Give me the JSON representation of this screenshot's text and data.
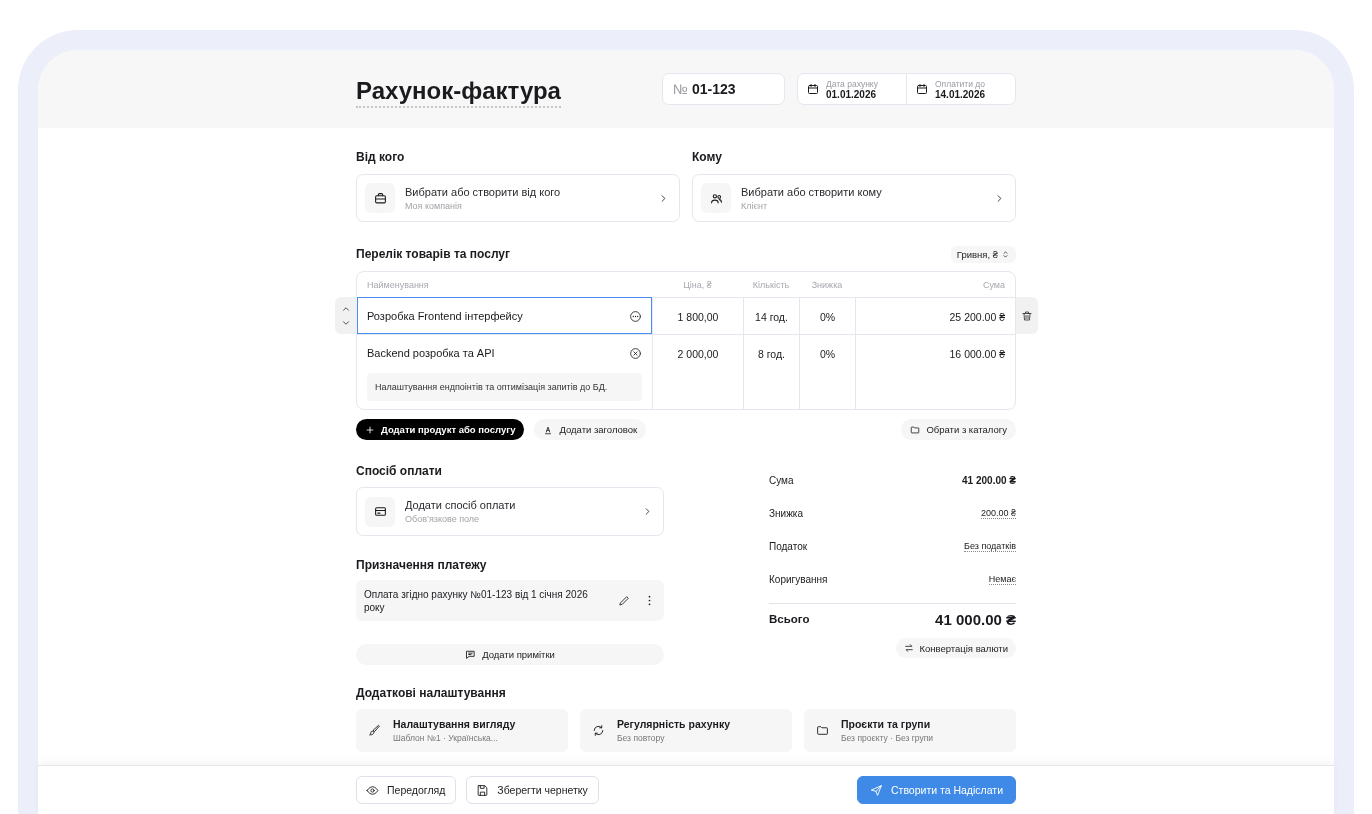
{
  "header": {
    "title": "Рахунок-фактура",
    "number_prefix": "№",
    "number": "01-123",
    "dates": [
      {
        "label": "Дата рахунку",
        "value": "01.01.2026"
      },
      {
        "label": "Оплатити до",
        "value": "14.01.2026"
      }
    ]
  },
  "parties": [
    {
      "heading": "Від кого",
      "title": "Вибрати або створити від кого",
      "subtitle": "Моя компанія"
    },
    {
      "heading": "Кому",
      "title": "Вибрати або створити кому",
      "subtitle": "Клієнт"
    }
  ],
  "items": {
    "heading": "Перелік товарів та послуг",
    "currency": "Гривня, ₴",
    "columns": [
      "Найменування",
      "Ціна, ₴",
      "Кількість",
      "Знижка",
      "Сума"
    ],
    "rows": [
      {
        "selected": true,
        "name": "Розробка Frontend інтерфейсу",
        "price": "1 800,00",
        "quantity": "14 год.",
        "discount": "0%",
        "sum": "25 200.00 ₴"
      },
      {
        "selected": false,
        "name": "Backend розробка та API",
        "description": "Налаштування ендпоінтів та оптимізація запитів до БД.",
        "price": "2 000,00",
        "quantity": "8 год.",
        "discount": "0%",
        "sum": "16 000.00 ₴"
      }
    ],
    "actions": [
      {
        "kind": "primary",
        "label": "Додати продукт або послугу"
      },
      {
        "kind": "heading",
        "label": "Додати заголовок"
      },
      {
        "kind": "catalog",
        "label": "Обрати з каталогу"
      }
    ]
  },
  "payment_method": {
    "heading": "Спосіб оплати",
    "title": "Додати спосіб оплати",
    "subtitle": "Обов’язкове поле"
  },
  "payment_purpose": {
    "heading": "Призначення платежу",
    "text": "Оплата згідно рахунку №01-123 від 1 січня 2026 року"
  },
  "notes_button": "Додати примітки",
  "totals": {
    "rows": [
      {
        "kind": "strong",
        "label": "Сума",
        "value": "41 200.00 ₴"
      },
      {
        "kind": "link",
        "label": "Знижка",
        "value": "200.00 ₴"
      },
      {
        "kind": "link",
        "label": "Податок",
        "value": "Без податків"
      },
      {
        "kind": "link",
        "label": "Коригування",
        "value": "Немає"
      }
    ],
    "total_label": "Всього",
    "total_value": "41 000.00 ₴",
    "conversion": "Конвертація валюти"
  },
  "settings": {
    "heading": "Додаткові налаштування",
    "cards": [
      {
        "title": "Налаштування вигляду",
        "subtitle": "Шаблон №1 · Українська..."
      },
      {
        "title": "Регулярність рахунку",
        "subtitle": "Без повтору"
      },
      {
        "title": "Проєкти та групи",
        "subtitle": "Без проєкту · Без групи"
      }
    ]
  },
  "footer": {
    "buttons": [
      {
        "kind": "outline",
        "label": "Передогляд"
      },
      {
        "kind": "outline",
        "label": "Зберегти чернетку"
      },
      {
        "kind": "primary",
        "label": "Створити та Надіслати"
      }
    ]
  }
}
